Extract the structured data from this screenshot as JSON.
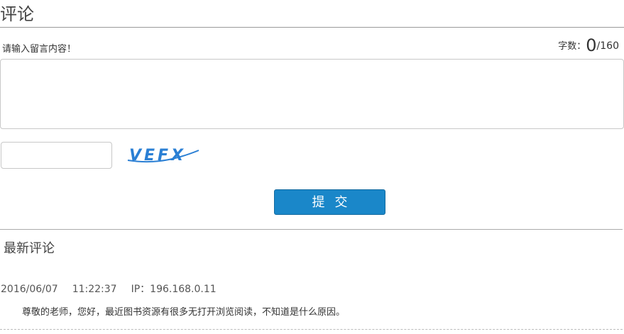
{
  "comment_section": {
    "title": "评论",
    "prompt": "请输入留言内容！",
    "counter": {
      "label": "字数：",
      "current": "0",
      "max": "/160"
    },
    "textarea_value": "",
    "captcha": {
      "input_value": "",
      "image_text": "VEFX"
    },
    "submit_label": "提交"
  },
  "latest": {
    "title": "最新评论",
    "comments": [
      {
        "date": "2016/06/07",
        "time": "11:22:37",
        "ip": "IP：196.168.0.11",
        "text": "尊敬的老师，您好，最近图书资源有很多无打开浏览阅读，不知道是什么原因。"
      }
    ]
  },
  "colors": {
    "accent": "#1a87c9",
    "captcha_text": "#2a7fd4"
  }
}
